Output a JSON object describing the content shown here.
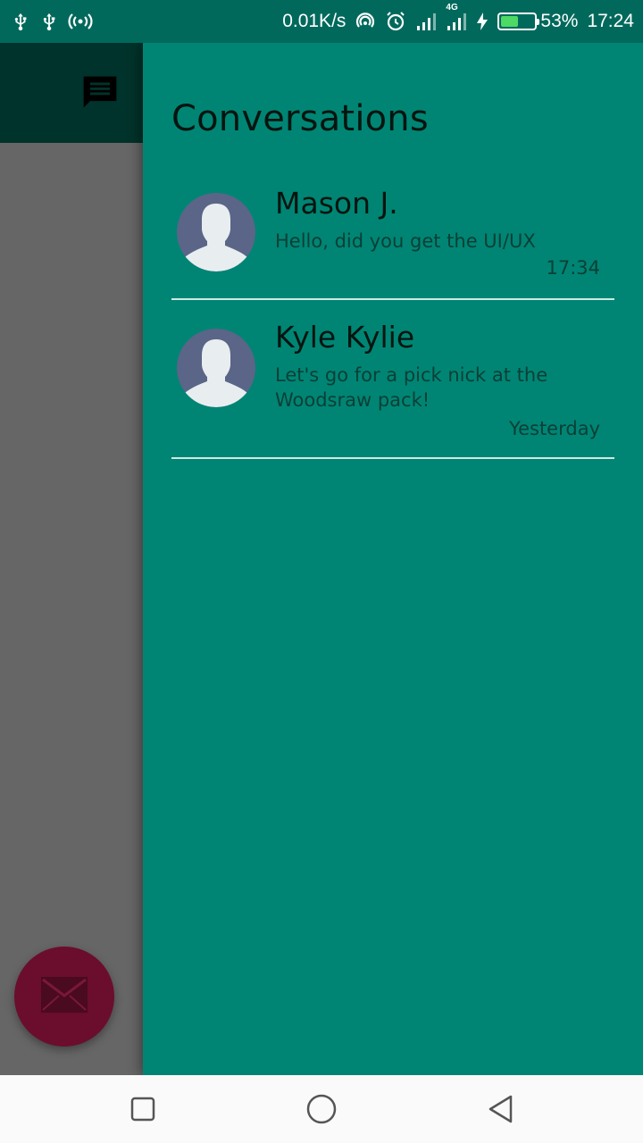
{
  "status_bar": {
    "left_icons": [
      "usb-icon",
      "usb-icon",
      "hotspot-icon"
    ],
    "network_speed": "0.01K/s",
    "right_icons": [
      "nfc-icon",
      "alarm-icon",
      "signal-icon",
      "signal-4g-icon",
      "charging-icon"
    ],
    "network_type": "4G",
    "battery_percent": "53%",
    "battery_level": 0.53,
    "time": "17:24"
  },
  "toolbar": {
    "icon": "chat-icon"
  },
  "fab": {
    "icon": "mail-icon",
    "color": "#6b0d2c"
  },
  "drawer": {
    "title": "Conversations",
    "conversations": [
      {
        "name": "Mason J.",
        "message": "Hello, did you get the UI/UX",
        "time": "17:34",
        "avatar_icon": "person-icon"
      },
      {
        "name": "Kyle Kylie",
        "message": "Let's go for a pick nick at the Woodsraw pack!",
        "time": "Yesterday",
        "avatar_icon": "person-icon"
      }
    ]
  },
  "nav_bar": {
    "icons": [
      "recents-square-icon",
      "home-circle-icon",
      "back-triangle-icon"
    ]
  },
  "colors": {
    "status_bar": "#00695c",
    "drawer": "#008574",
    "toolbar": "#00332b",
    "scrim": "#666666",
    "avatar": "#5a6587"
  }
}
